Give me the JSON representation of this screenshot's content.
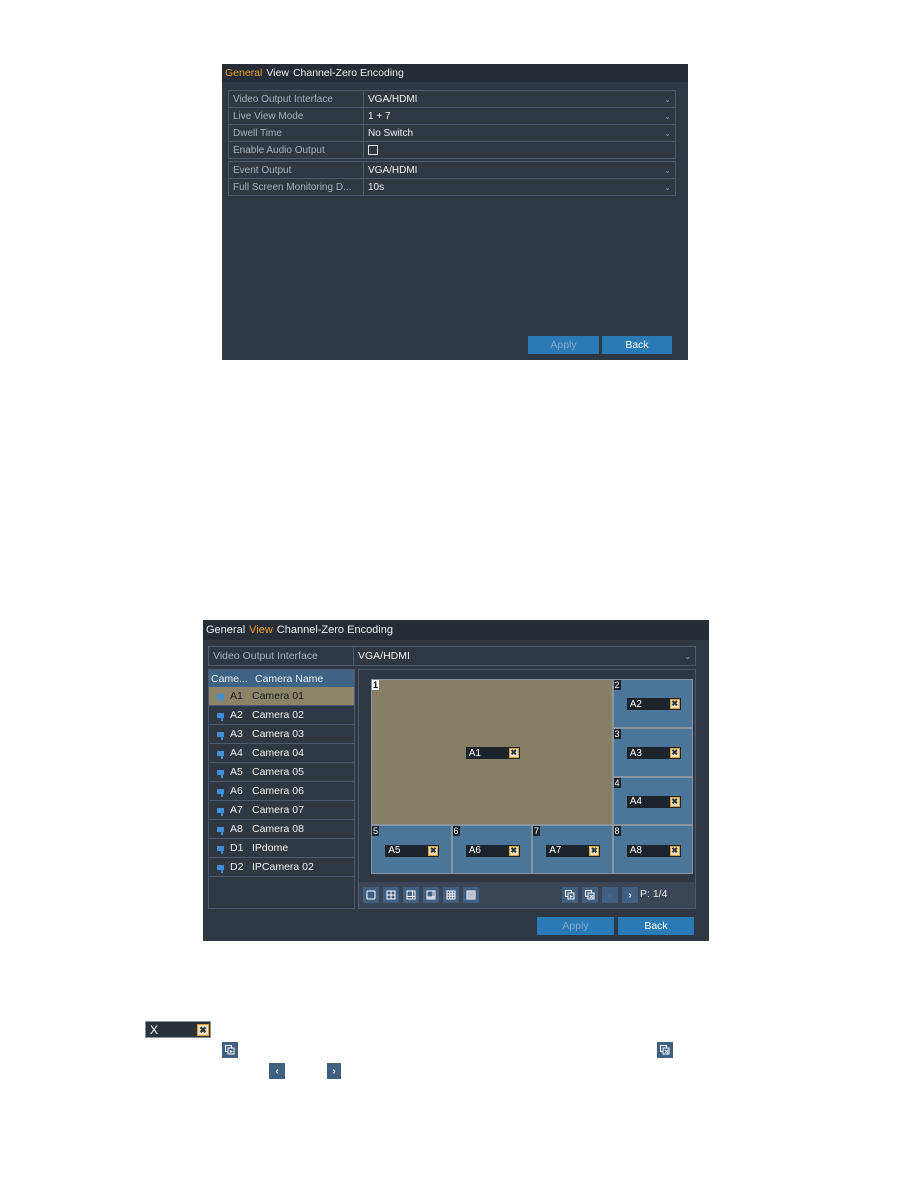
{
  "panel_general": {
    "tabs": [
      {
        "label": "General",
        "active": true
      },
      {
        "label": "View",
        "active": false
      },
      {
        "label": "Channel-Zero Encoding",
        "active": false
      }
    ],
    "rows_group1": [
      {
        "label": "Video Output Interface",
        "value": "VGA/HDMI",
        "type": "select"
      },
      {
        "label": "Live View Mode",
        "value": "1 + 7",
        "type": "select"
      },
      {
        "label": "Dwell Time",
        "value": "No Switch",
        "type": "select"
      },
      {
        "label": "Enable Audio Output",
        "value": "",
        "type": "checkbox",
        "checked": false
      }
    ],
    "rows_group2": [
      {
        "label": "Event Output",
        "value": "VGA/HDMI",
        "type": "select"
      },
      {
        "label": "Full Screen Monitoring D...",
        "value": "10s",
        "type": "select"
      }
    ],
    "apply_label": "Apply",
    "back_label": "Back"
  },
  "panel_view": {
    "tabs": [
      {
        "label": "General",
        "active": false
      },
      {
        "label": "View",
        "active": true
      },
      {
        "label": "Channel-Zero Encoding",
        "active": false
      }
    ],
    "video_output": {
      "label": "Video Output Interface",
      "value": "VGA/HDMI"
    },
    "camera_list": {
      "headers": [
        "Came...",
        "Camera Name"
      ],
      "rows": [
        {
          "id": "A1",
          "name": "Camera 01",
          "selected": true
        },
        {
          "id": "A2",
          "name": "Camera 02",
          "selected": false
        },
        {
          "id": "A3",
          "name": "Camera 03",
          "selected": false
        },
        {
          "id": "A4",
          "name": "Camera 04",
          "selected": false
        },
        {
          "id": "A5",
          "name": "Camera 05",
          "selected": false
        },
        {
          "id": "A6",
          "name": "Camera 06",
          "selected": false
        },
        {
          "id": "A7",
          "name": "Camera 07",
          "selected": false
        },
        {
          "id": "A8",
          "name": "Camera 08",
          "selected": false
        },
        {
          "id": "D1",
          "name": "IPdome",
          "selected": false
        },
        {
          "id": "D2",
          "name": "IPCamera 02",
          "selected": false
        }
      ]
    },
    "windows": [
      {
        "num": "1",
        "camera": "A1"
      },
      {
        "num": "2",
        "camera": "A2"
      },
      {
        "num": "3",
        "camera": "A3"
      },
      {
        "num": "4",
        "camera": "A4"
      },
      {
        "num": "5",
        "camera": "A5"
      },
      {
        "num": "6",
        "camera": "A6"
      },
      {
        "num": "7",
        "camera": "A7"
      },
      {
        "num": "8",
        "camera": "A8"
      }
    ],
    "toolbar": {
      "layout_buttons": [
        "layout-1",
        "layout-4",
        "layout-6",
        "layout-8",
        "layout-9",
        "layout-16"
      ],
      "page_label": "P: 1/4"
    },
    "apply_label": "Apply",
    "back_label": "Back"
  },
  "legend": {
    "chip_label": "X",
    "chip_close": "✕"
  }
}
